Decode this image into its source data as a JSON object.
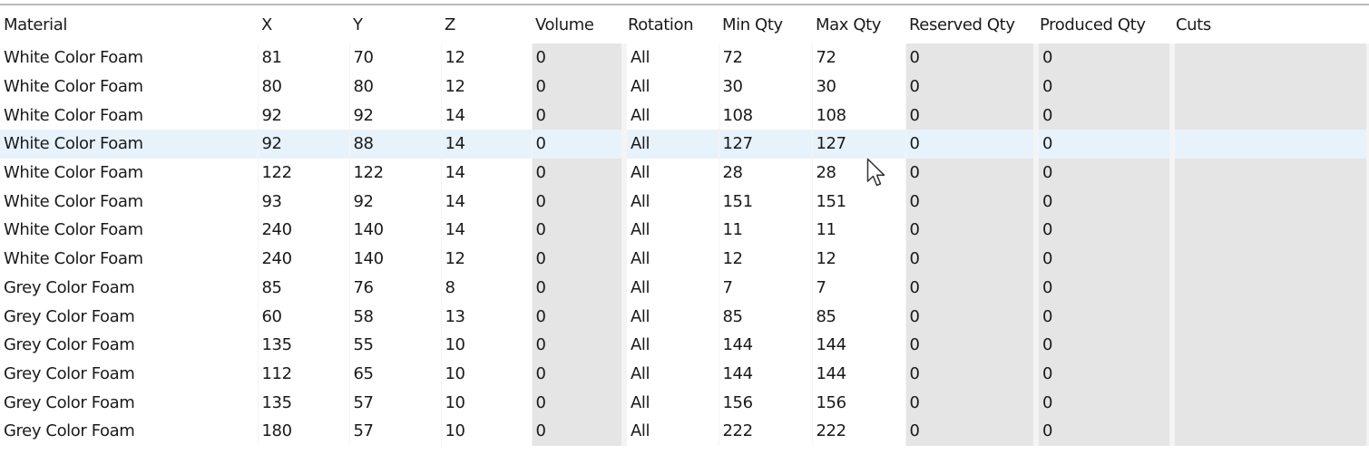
{
  "grid": {
    "columns": [
      "Material",
      "X",
      "Y",
      "Z",
      "Volume",
      "Rotation",
      "Min Qty",
      "Max Qty",
      "Reserved Qty",
      "Produced Qty",
      "Cuts"
    ],
    "selected_row": 3,
    "rows": [
      {
        "material": "White Color Foam",
        "x": "81",
        "y": "70",
        "z": "12",
        "volume": "0",
        "rotation": "All",
        "min_qty": "72",
        "max_qty": "72",
        "reserved_qty": "0",
        "produced_qty": "0",
        "cuts": ""
      },
      {
        "material": "White Color Foam",
        "x": "80",
        "y": "80",
        "z": "12",
        "volume": "0",
        "rotation": "All",
        "min_qty": "30",
        "max_qty": "30",
        "reserved_qty": "0",
        "produced_qty": "0",
        "cuts": ""
      },
      {
        "material": "White Color Foam",
        "x": "92",
        "y": "92",
        "z": "14",
        "volume": "0",
        "rotation": "All",
        "min_qty": "108",
        "max_qty": "108",
        "reserved_qty": "0",
        "produced_qty": "0",
        "cuts": ""
      },
      {
        "material": "White Color Foam",
        "x": "92",
        "y": "88",
        "z": "14",
        "volume": "0",
        "rotation": "All",
        "min_qty": "127",
        "max_qty": "127",
        "reserved_qty": "0",
        "produced_qty": "0",
        "cuts": ""
      },
      {
        "material": "White Color Foam",
        "x": "122",
        "y": "122",
        "z": "14",
        "volume": "0",
        "rotation": "All",
        "min_qty": "28",
        "max_qty": "28",
        "reserved_qty": "0",
        "produced_qty": "0",
        "cuts": ""
      },
      {
        "material": "White Color Foam",
        "x": "93",
        "y": "92",
        "z": "14",
        "volume": "0",
        "rotation": "All",
        "min_qty": "151",
        "max_qty": "151",
        "reserved_qty": "0",
        "produced_qty": "0",
        "cuts": ""
      },
      {
        "material": "White Color Foam",
        "x": "240",
        "y": "140",
        "z": "14",
        "volume": "0",
        "rotation": "All",
        "min_qty": "11",
        "max_qty": "11",
        "reserved_qty": "0",
        "produced_qty": "0",
        "cuts": ""
      },
      {
        "material": "White Color Foam",
        "x": "240",
        "y": "140",
        "z": "12",
        "volume": "0",
        "rotation": "All",
        "min_qty": "12",
        "max_qty": "12",
        "reserved_qty": "0",
        "produced_qty": "0",
        "cuts": ""
      },
      {
        "material": "Grey Color Foam",
        "x": "85",
        "y": "76",
        "z": "8",
        "volume": "0",
        "rotation": "All",
        "min_qty": "7",
        "max_qty": "7",
        "reserved_qty": "0",
        "produced_qty": "0",
        "cuts": ""
      },
      {
        "material": "Grey Color Foam",
        "x": "60",
        "y": "58",
        "z": "13",
        "volume": "0",
        "rotation": "All",
        "min_qty": "85",
        "max_qty": "85",
        "reserved_qty": "0",
        "produced_qty": "0",
        "cuts": ""
      },
      {
        "material": "Grey Color Foam",
        "x": "135",
        "y": "55",
        "z": "10",
        "volume": "0",
        "rotation": "All",
        "min_qty": "144",
        "max_qty": "144",
        "reserved_qty": "0",
        "produced_qty": "0",
        "cuts": ""
      },
      {
        "material": "Grey Color Foam",
        "x": "112",
        "y": "65",
        "z": "10",
        "volume": "0",
        "rotation": "All",
        "min_qty": "144",
        "max_qty": "144",
        "reserved_qty": "0",
        "produced_qty": "0",
        "cuts": ""
      },
      {
        "material": "Grey Color Foam",
        "x": "135",
        "y": "57",
        "z": "10",
        "volume": "0",
        "rotation": "All",
        "min_qty": "156",
        "max_qty": "156",
        "reserved_qty": "0",
        "produced_qty": "0",
        "cuts": ""
      },
      {
        "material": "Grey Color Foam",
        "x": "180",
        "y": "57",
        "z": "10",
        "volume": "0",
        "rotation": "All",
        "min_qty": "222",
        "max_qty": "222",
        "reserved_qty": "0",
        "produced_qty": "0",
        "cuts": ""
      }
    ]
  },
  "cursor_icon": "mouse-pointer-icon",
  "colors": {
    "readonly_cell": "#e5e5e5",
    "selected_row": "#e8f2fb",
    "top_border": "#b9b9b9"
  }
}
